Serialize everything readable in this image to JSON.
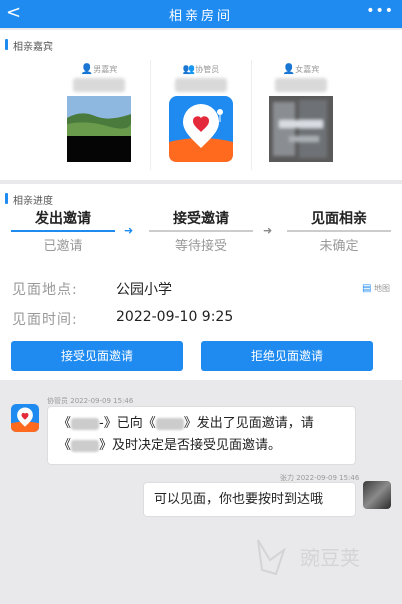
{
  "titlebar": {
    "back_glyph": "<",
    "title": "相亲房间",
    "more_glyph": "•••"
  },
  "guests_section": {
    "title": "相亲嘉宾",
    "guests": [
      {
        "role": "男嘉宾",
        "icon": "person-icon"
      },
      {
        "role": "协管员",
        "icon": "people-icon"
      },
      {
        "role": "女嘉宾",
        "icon": "person-icon"
      }
    ]
  },
  "progress_section": {
    "title": "相亲进度",
    "steps": [
      {
        "title": "发出邀请",
        "status": "已邀请",
        "active": true
      },
      {
        "title": "接受邀请",
        "status": "等待接受",
        "active": false
      },
      {
        "title": "见面相亲",
        "status": "未确定",
        "active": false
      }
    ],
    "location_label": "见面地点:",
    "location_value": "公园小学",
    "map_label": "地图",
    "time_label": "见面时间:",
    "time_value": "2022-09-10 9:25",
    "accept_button": "接受见面邀请",
    "reject_button": "拒绝见面邀请"
  },
  "chat": {
    "messages": [
      {
        "sender": "协管员",
        "time": "2022-09-09 15:46",
        "text_parts": [
          "《",
          "-》已向《",
          "》发出了见面邀请，请",
          "《",
          "》及时决定是否接受见面邀请。"
        ]
      },
      {
        "sender": "张力",
        "time": "2022-09-09 15:46",
        "text": "可以见面，你也要按时到达哦"
      }
    ]
  },
  "watermark": "豌豆荚",
  "colors": {
    "accent": "#1f8bf1",
    "background": "#e9e9ec"
  }
}
